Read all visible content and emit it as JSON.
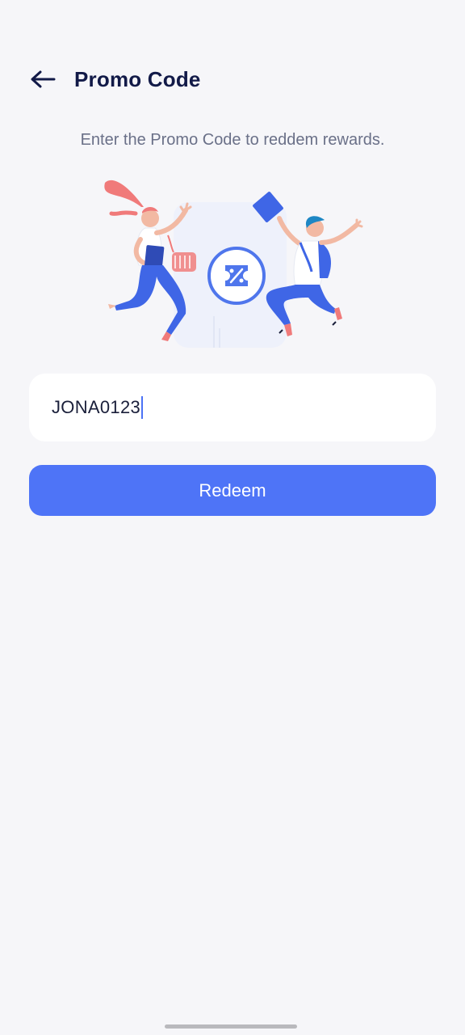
{
  "header": {
    "title": "Promo Code",
    "back_icon": "arrow-left-icon"
  },
  "subtitle": "Enter the Promo Code to reddem rewards.",
  "illustration": {
    "icons": [
      "discount-ticket-icon"
    ]
  },
  "promo_input": {
    "value": "JONA0123"
  },
  "redeem_button": {
    "label": "Redeem"
  },
  "colors": {
    "primary": "#4E74F7",
    "background": "#F6F6F9",
    "title": "#121A48",
    "subtitle": "#6A7088"
  }
}
